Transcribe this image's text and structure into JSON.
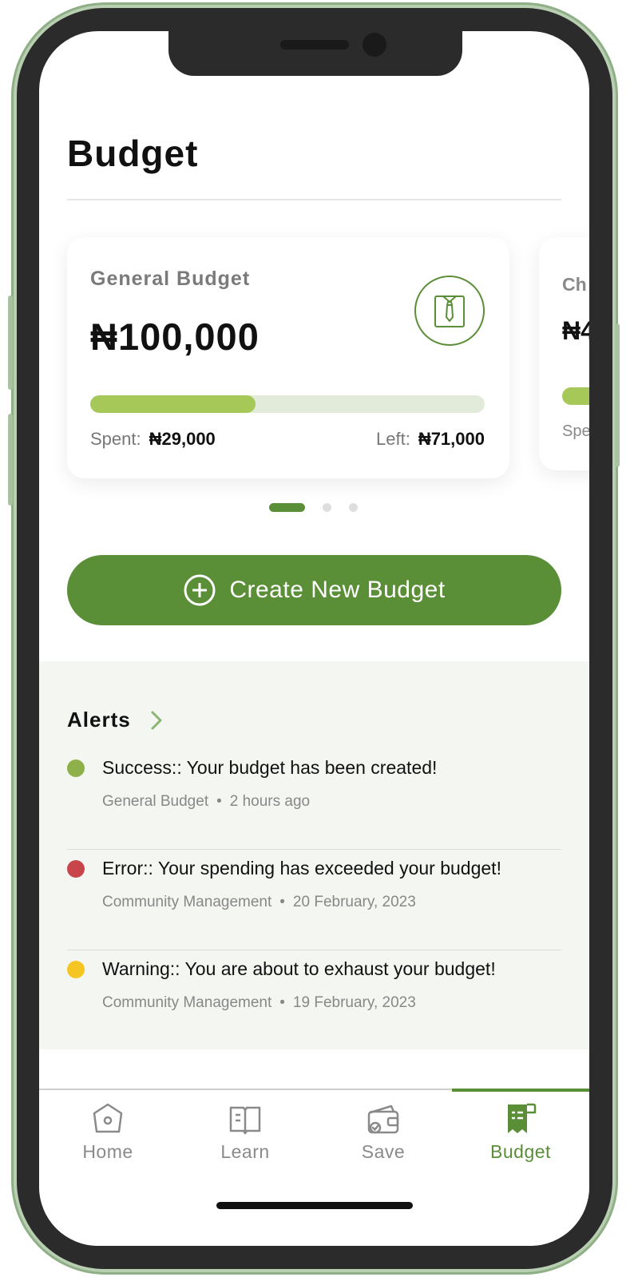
{
  "header": {
    "title": "Budget"
  },
  "budget_cards": [
    {
      "label": "General Budget",
      "amount": "₦100,000",
      "progress": 0.42,
      "spent_label": "Spent:",
      "spent_value": "₦29,000",
      "left_label": "Left:",
      "left_value": "₦71,000",
      "icon": "shirt-tie-icon"
    },
    {
      "label": "Ch",
      "amount": "₦4",
      "spent_label": "Spe"
    }
  ],
  "pagination": {
    "count": 3,
    "active": 0
  },
  "create_button": {
    "label": "Create New Budget",
    "icon": "plus-circle-icon"
  },
  "alerts": {
    "title": "Alerts",
    "items": [
      {
        "message": "Success:: Your budget has been created!",
        "source": "General Budget",
        "time": "2 hours ago",
        "status": "success",
        "color": "#8db04a"
      },
      {
        "message": "Error:: Your spending has exceeded your budget!",
        "source": "Community Management",
        "time": "20 February, 2023",
        "status": "error",
        "color": "#c8464b"
      },
      {
        "message": "Warning:: You are about to exhaust your budget!",
        "source": "Community Management",
        "time": "19 February, 2023",
        "status": "warning",
        "color": "#f5c623"
      }
    ]
  },
  "tabbar": {
    "items": [
      {
        "label": "Home",
        "icon": "home-icon"
      },
      {
        "label": "Learn",
        "icon": "book-icon"
      },
      {
        "label": "Save",
        "icon": "wallet-icon"
      },
      {
        "label": "Budget",
        "icon": "receipt-icon",
        "active": true
      }
    ]
  },
  "colors": {
    "accent": "#5a8e37",
    "progress": "#a6c858",
    "track": "#e2ebd9"
  }
}
